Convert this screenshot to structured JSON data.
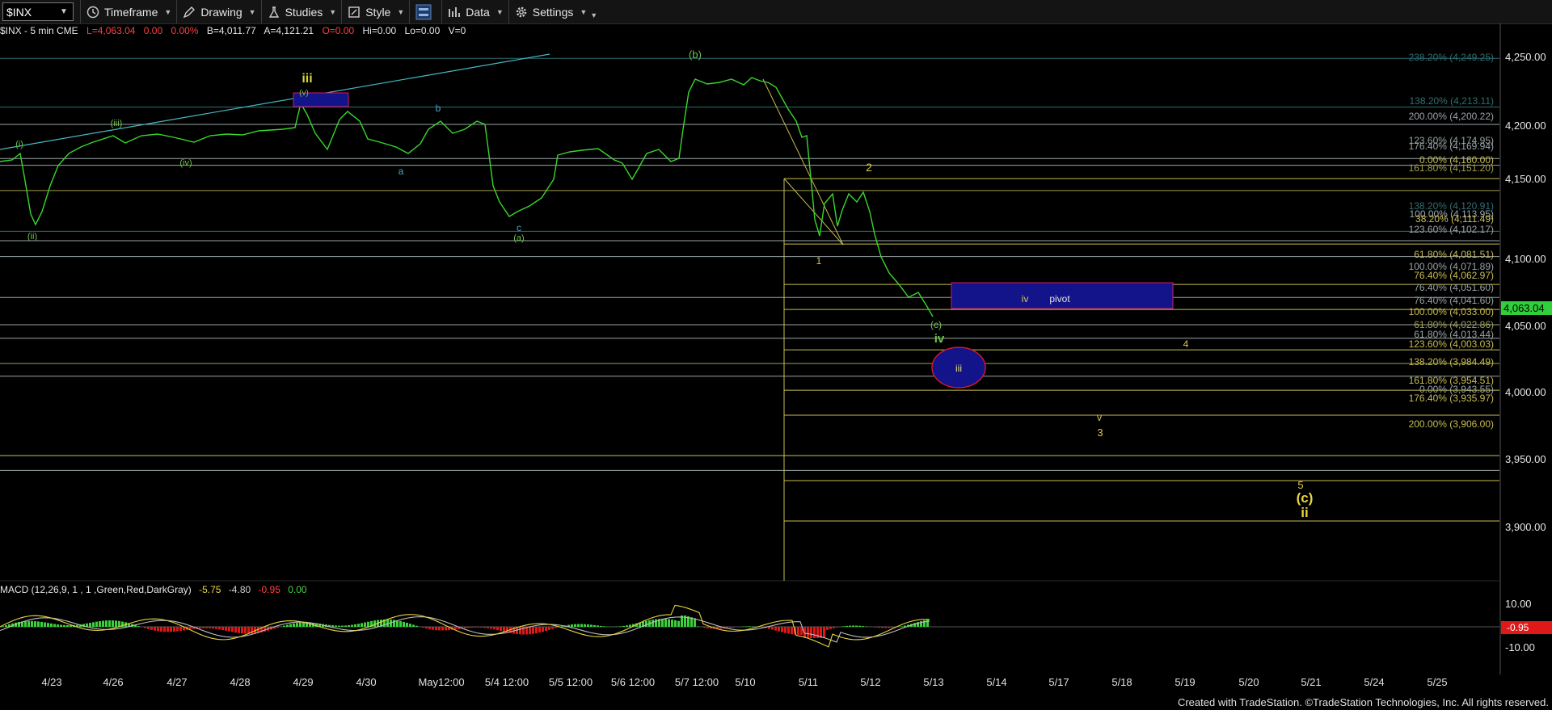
{
  "toolbar": {
    "symbol": "$INX",
    "buttons": [
      "Timeframe",
      "Drawing",
      "Studies",
      "Style",
      "Data",
      "Settings"
    ]
  },
  "status": {
    "symbol_line": "$INX - 5 min  CME",
    "low": "L=4,063.04",
    "change": "0.00",
    "pct": "0.00%",
    "bid": "B=4,011.77",
    "ask": "A=4,121.21",
    "open": "O=0.00",
    "hi": "Hi=0.00",
    "lo": "Lo=0.00",
    "vol": "V=0"
  },
  "price_axis": {
    "range": [
      3845,
      4275
    ],
    "labels": [
      "4,250.00",
      "4,200.00",
      "4,150.00",
      "4,100.00",
      "4,050.00",
      "4,000.00",
      "3,950.00",
      "3,900.00"
    ],
    "last_price": "4,063.04"
  },
  "macd": {
    "label": "MACD (12,26,9, 1 , 1 ,Green,Red,DarkGray)",
    "v1": "-5.75",
    "v2": "-4.80",
    "v3": "-0.95",
    "v4": "0.00",
    "axis_labels": [
      "10.00",
      "-10.00"
    ],
    "last": "-0.95"
  },
  "dates": [
    "4/23",
    "4/26",
    "4/27",
    "4/28",
    "4/29",
    "4/30",
    "May12:00",
    "5/4 12:00",
    "5/5 12:00",
    "5/6 12:00",
    "5/7 12:00",
    "5/10",
    "5/11",
    "5/12",
    "5/13",
    "5/14",
    "5/17",
    "5/18",
    "5/19",
    "5/20",
    "5/21",
    "5/24",
    "5/25"
  ],
  "fib_levels": [
    {
      "label": "238.20% (4,249.25)",
      "value": 4249.25,
      "color": "#2f6f73"
    },
    {
      "label": "138.20% (4,213.11)",
      "value": 4213.11,
      "color": "#2f6f73"
    },
    {
      "label": "200.00% (4,200.22)",
      "value": 4200.22,
      "color": "#9aa3a6"
    },
    {
      "label": "123.60% (4,174.95)",
      "value": 4174.95,
      "color": "#9aa3a6"
    },
    {
      "label": "176.40% (4,169.94)",
      "value": 4169.94,
      "color": "#9aa3a6"
    },
    {
      "label": "0.00% (4,160.00)",
      "value": 4160.0,
      "color": "#c8bd52"
    },
    {
      "label": "161.80% (4,151.20)",
      "value": 4151.2,
      "color": "#a2a04c"
    },
    {
      "label": "138.20% (4,120.91)",
      "value": 4120.91,
      "color": "#2f6f73"
    },
    {
      "label": "100.00% (4,113.95)",
      "value": 4113.95,
      "color": "#9aa3a6"
    },
    {
      "label": "38.20% (4,111.49)",
      "value": 4111.49,
      "color": "#c8bd52"
    },
    {
      "label": "123.60% (4,102.17)",
      "value": 4102.17,
      "color": "#9aa3a6"
    },
    {
      "label": "61.80% (4,081.51)",
      "value": 4081.51,
      "color": "#c8bd52"
    },
    {
      "label": "100.00% (4,071.89)",
      "value": 4071.89,
      "color": "#9aa3a6"
    },
    {
      "label": "76.40% (4,062.97)",
      "value": 4062.97,
      "color": "#c8bd52"
    },
    {
      "label": "76.40% (4,051.60)",
      "value": 4051.6,
      "color": "#9aa3a6"
    },
    {
      "label": "76.40% (4,041.60)",
      "value": 4041.6,
      "color": "#9aa3a6"
    },
    {
      "label": "100.00% (4,033.00)",
      "value": 4033.0,
      "color": "#c8bd52"
    },
    {
      "label": "61.80% (4,022.86)",
      "value": 4022.86,
      "color": "#a2a04c"
    },
    {
      "label": "61.80% (4,013.44)",
      "value": 4013.44,
      "color": "#9aa3a6"
    },
    {
      "label": "123.60% (4,003.03)",
      "value": 4003.03,
      "color": "#c8bd52"
    },
    {
      "label": "138.20% (3,984.49)",
      "value": 3984.49,
      "color": "#c8bd52"
    },
    {
      "label": "161.80% (3,954.51)",
      "value": 3954.51,
      "color": "#c8bd52"
    },
    {
      "label": "0.00% (3,943.55)",
      "value": 3943.55,
      "color": "#9aa3a6"
    },
    {
      "label": "176.40% (3,935.97)",
      "value": 3935.97,
      "color": "#c8bd52"
    },
    {
      "label": "200.00% (3,906.00)",
      "value": 3906.0,
      "color": "#c8bd52"
    }
  ],
  "wave_labels": [
    {
      "text": "iii",
      "color": "#d7d435"
    },
    {
      "text": "(b)",
      "color": "#6fc24a"
    },
    {
      "text": "(i)",
      "color": "#6fc24a"
    },
    {
      "text": "(ii)",
      "color": "#6fc24a"
    },
    {
      "text": "(iii)",
      "color": "#6fc24a"
    },
    {
      "text": "(iv)",
      "color": "#6fc24a"
    },
    {
      "text": "(v)",
      "color": "#6fc24a"
    },
    {
      "text": "b",
      "color": "#4fa3c8"
    },
    {
      "text": "a",
      "color": "#4fa3c8"
    },
    {
      "text": "c",
      "color": "#4fa3c8"
    },
    {
      "text": "(a)",
      "color": "#6fc24a"
    },
    {
      "text": "1",
      "color": "#d7c850"
    },
    {
      "text": "2",
      "color": "#d7c850"
    },
    {
      "text": "(c)",
      "color": "#6fc24a"
    },
    {
      "text": "iv",
      "color": "#6fc24a"
    },
    {
      "text": "iv",
      "color": "#d7c850"
    },
    {
      "text": "pivot",
      "color": "#e0e0e0"
    },
    {
      "text": "iii",
      "color": "#e8e07a"
    },
    {
      "text": "4",
      "color": "#d7c850"
    },
    {
      "text": "v",
      "color": "#d7c850"
    },
    {
      "text": "3",
      "color": "#d7c850"
    },
    {
      "text": "5",
      "color": "#d7c850"
    },
    {
      "text": "(c)",
      "color": "#e8d640"
    },
    {
      "text": "ii",
      "color": "#e8d640"
    }
  ],
  "credit": "Created with TradeStation. ©TradeStation Technologies, Inc. All rights reserved."
}
